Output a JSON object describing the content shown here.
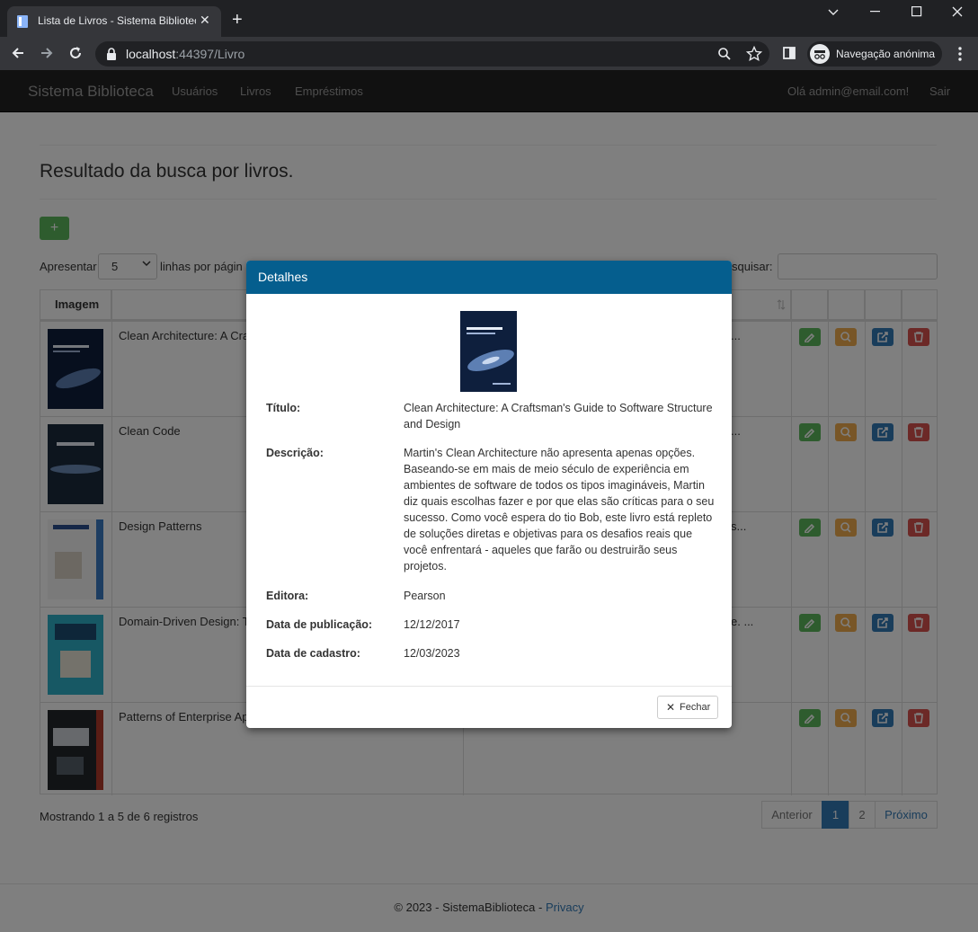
{
  "browser": {
    "tab_title": "Lista de Livros - Sistema Bibliotec",
    "url_host": "localhost",
    "url_rest": ":44397/Livro",
    "incognito_label": "Navegação anónima"
  },
  "app": {
    "brand": "Sistema Biblioteca",
    "nav": [
      "Usuários",
      "Livros",
      "Empréstimos"
    ],
    "greeting": "Olá admin@email.com!",
    "logout": "Sair"
  },
  "page": {
    "title": "Resultado da busca por livros.",
    "add_label": "+",
    "length_prefix": "Apresentar",
    "length_value": "5",
    "length_suffix": "linhas por págin",
    "search_label": "squisar:",
    "info": "Mostrando 1 a 5 de 6 registros"
  },
  "table": {
    "columns": [
      "Imagem"
    ],
    "rows": [
      {
        "title": "Clean Architecture: A Craf",
        "desc": "..."
      },
      {
        "title": "Clean Code",
        "desc": "..."
      },
      {
        "title": "Design Patterns",
        "desc": "s..."
      },
      {
        "title": "Domain-Driven Design: Ta",
        "desc": "e. ..."
      },
      {
        "title": "Patterns of Enterprise App",
        "desc": ""
      }
    ]
  },
  "pagination": {
    "prev": "Anterior",
    "pages": [
      "1",
      "2"
    ],
    "next": "Próximo"
  },
  "footer": {
    "text": "© 2023 - SistemaBiblioteca - ",
    "link": "Privacy"
  },
  "modal": {
    "title": "Detalhes",
    "fields": [
      {
        "label": "Título:",
        "value": "Clean Architecture: A Craftsman's Guide to Software Structure and Design"
      },
      {
        "label": "Descrição:",
        "value": "Martin's Clean Architecture não apresenta apenas opções. Baseando-se em mais de meio século de experiência em ambientes de software de todos os tipos imagináveis, Martin diz quais escolhas fazer e por que elas são críticas para o seu sucesso. Como você espera do tio Bob, este livro está repleto de soluções diretas e objetivas para os desafios reais que você enfrentará - aqueles que farão ou destruirão seus projetos."
      },
      {
        "label": "Editora:",
        "value": "Pearson"
      },
      {
        "label": "Data de publicação:",
        "value": "12/12/2017"
      },
      {
        "label": "Data de cadastro:",
        "value": "12/03/2023"
      }
    ],
    "close_label": "Fechar"
  },
  "colors": {
    "modal_header": "#055e8e",
    "edit": "#5cb85c",
    "view": "#f0ad4e",
    "open": "#337ab7",
    "delete": "#d9534f"
  }
}
